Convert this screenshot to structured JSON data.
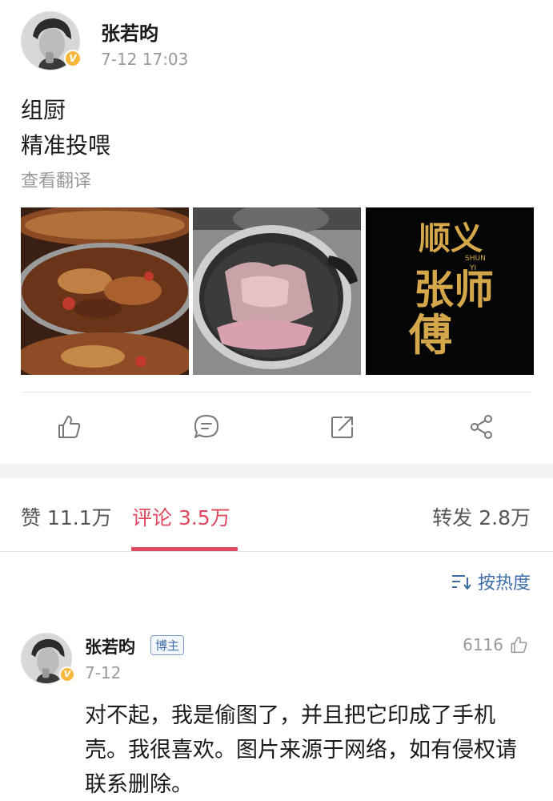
{
  "post": {
    "author": "张若昀",
    "time": "7-12 17:03",
    "verified_badge": "V",
    "text_line1": "组厨",
    "text_line2": "精准投喂",
    "translate": "查看翻译",
    "photo3_title": "顺义张师傅",
    "photo3_subtitle": "SHUN YI",
    "accent_gold": "#d3a74a"
  },
  "actions": {
    "like_icon": "thumbs-up-icon",
    "comment_icon": "comment-icon",
    "repost_icon": "repost-icon",
    "share_icon": "share-icon"
  },
  "tabs": {
    "likes": "赞 11.1万",
    "comments": "评论 3.5万",
    "reposts": "转发 2.8万",
    "active_color": "#e0495e"
  },
  "sort": {
    "label": "按热度",
    "icon": "sort-icon"
  },
  "comment": {
    "author": "张若昀",
    "badge": "博主",
    "date": "7-12",
    "likes": "6116",
    "text": "对不起，我是偷图了，并且把它印成了手机壳。我很喜欢。图片来源于网络，如有侵权请联系删除。"
  }
}
